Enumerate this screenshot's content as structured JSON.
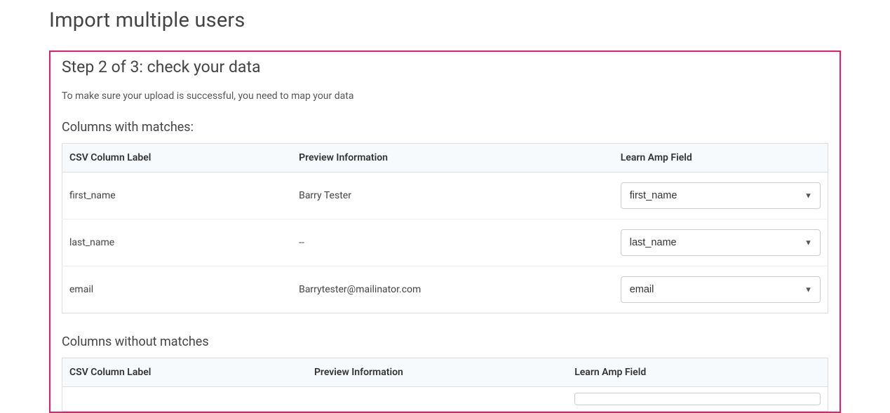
{
  "page_title": "Import multiple users",
  "step_heading": "Step 2 of 3: check your data",
  "helper_text": "To make sure your upload is successful, you need to map your data",
  "columns": {
    "csv_label": "CSV Column Label",
    "preview_info": "Preview Information",
    "learn_amp_field": "Learn Amp Field"
  },
  "matches": {
    "heading": "Columns with matches:",
    "rows": [
      {
        "csv": "first_name",
        "preview": "Barry Tester",
        "field": "first_name"
      },
      {
        "csv": "last_name",
        "preview": "--",
        "field": "last_name"
      },
      {
        "csv": "email",
        "preview": "Barrytester@mailinator.com",
        "field": "email"
      }
    ]
  },
  "unmatched": {
    "heading": "Columns without matches"
  },
  "field_options": [
    "first_name",
    "last_name",
    "email"
  ]
}
